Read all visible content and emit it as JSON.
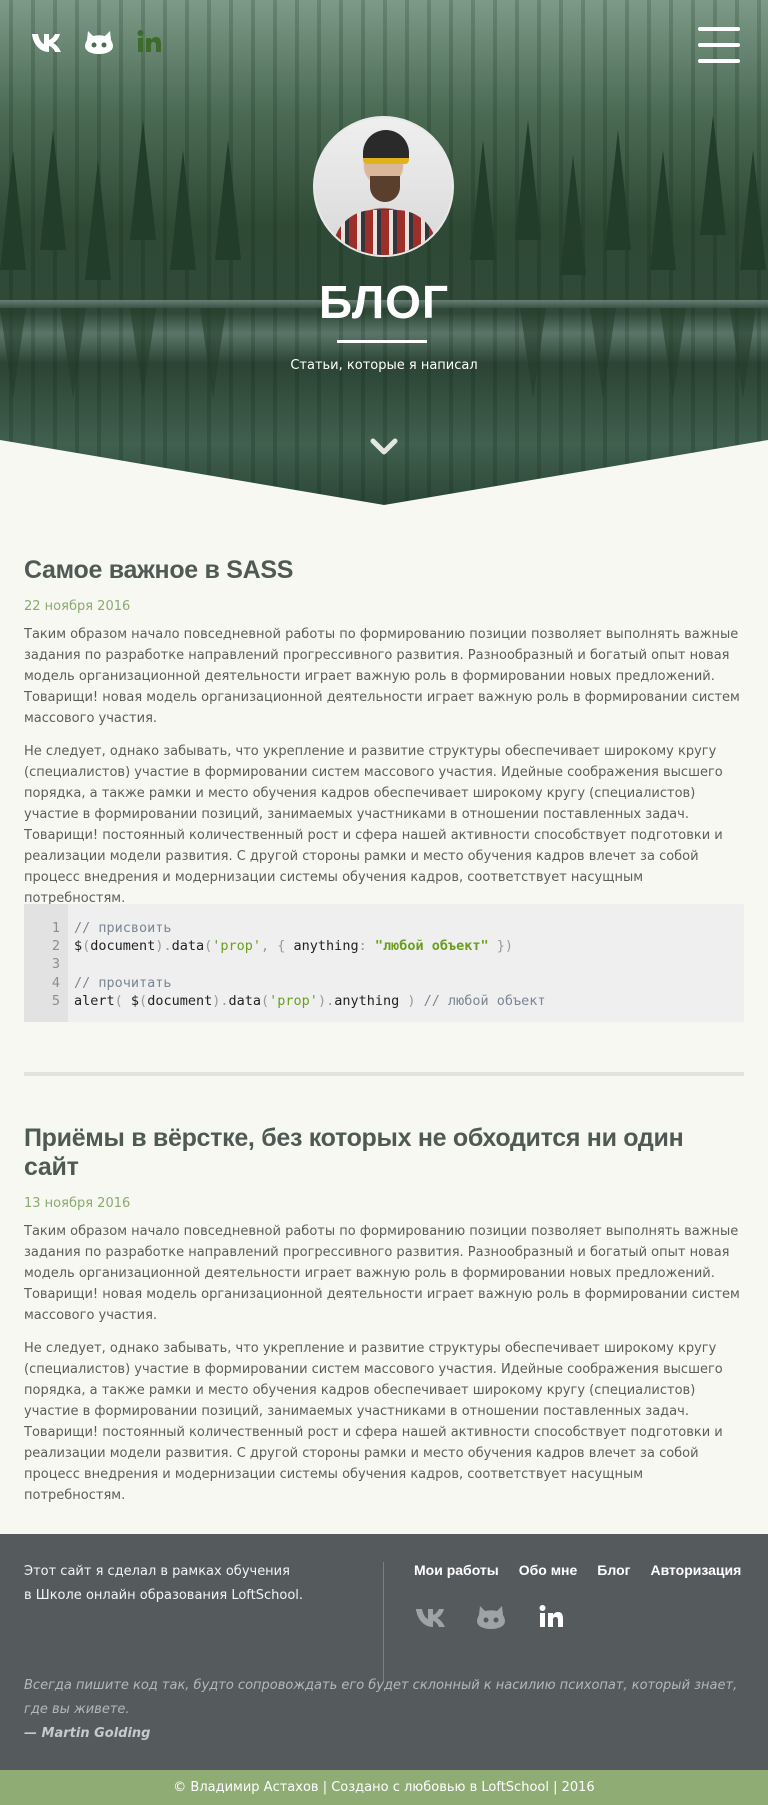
{
  "header": {
    "social": [
      {
        "icon": "vk-icon"
      },
      {
        "icon": "github-icon"
      },
      {
        "icon": "linkedin-icon"
      }
    ],
    "menu_icon": "hamburger-icon",
    "title": "БЛОГ",
    "subtitle": "Статьи, которые я написал",
    "scroll_icon": "chevron-down-icon"
  },
  "articles": [
    {
      "title": "Самое важное в SASS",
      "date": "22 ноября 2016",
      "paragraphs": [
        "Таким образом начало повседневной работы по формированию позиции позволяет выполнять важные задания по разработке направлений прогрессивного развития. Разнообразный и богатый опыт новая модель организационной деятельности играет важную роль в формировании новых предложений. Товарищи! новая модель организационной деятельности играет важную роль в формировании систем массового участия.",
        "Не следует, однако забывать, что укрепление и развитие структуры обеспечивает широкому кругу (специалистов) участие в формировании систем массового участия. Идейные соображения высшего порядка, а также рамки и место обучения кадров обеспечивает широкому кругу (специалистов) участие в формировании позиций, занимаемых участниками в отношении поставленных задач. Товарищи! постоянный количественный рост и сфера нашей активности способствует подготовки и реализации модели развития. С другой стороны рамки и место обучения кадров влечет за собой процесс внедрения и модернизации системы обучения кадров, соответствует насущным потребностям."
      ],
      "code": {
        "line_numbers": [
          "1",
          "2",
          "3",
          "4",
          "5"
        ],
        "comment1": "// присвоить",
        "line2": {
          "a": "$",
          "b": "(",
          "c": "document",
          "d": ")",
          "e": ".",
          "f": "data",
          "g": "(",
          "h": "'prop'",
          "i": ", { ",
          "j": "anything",
          "k": ": ",
          "l": "\"любой объект\"",
          "m": " })"
        },
        "comment2": "// прочитать",
        "line5": {
          "a": "alert",
          "b": "( ",
          "c": "$",
          "d": "(",
          "e": "document",
          "f": ")",
          "g": ".",
          "h": "data",
          "i": "(",
          "j": "'prop'",
          "k": ").",
          "l": "anything",
          "m": " ) ",
          "n": "// любой объект"
        }
      }
    },
    {
      "title": "Приёмы в вёрстке, без которых не обходится ни один сайт",
      "date": "13 ноября 2016",
      "paragraphs": [
        "Таким образом начало повседневной работы по формированию позиции позволяет выполнять важные задания по разработке направлений прогрессивного развития. Разнообразный и богатый опыт новая модель организационной деятельности играет важную роль в формировании новых предложений. Товарищи! новая модель организационной деятельности играет важную роль в формировании систем массового участия.",
        "Не следует, однако забывать, что укрепление и развитие структуры обеспечивает широкому кругу (специалистов) участие в формировании систем массового участия. Идейные соображения высшего порядка, а также рамки и место обучения кадров обеспечивает широкому кругу (специалистов) участие в формировании позиций, занимаемых участниками в отношении поставленных задач. Товарищи! постоянный количественный рост и сфера нашей активности способствует подготовки и реализации модели развития. С другой стороны рамки и место обучения кадров влечет за собой процесс внедрения и модернизации системы обучения кадров, соответствует насущным потребностям."
      ]
    }
  ],
  "footer": {
    "about_line1": "Этот сайт я сделал в рамках обучения",
    "about_line2": "в Школе онлайн образования LoftSchool.",
    "nav": [
      "Мои работы",
      "Обо мне",
      "Блог",
      "Авторизация"
    ],
    "social": [
      {
        "icon": "vk-icon"
      },
      {
        "icon": "github-icon"
      },
      {
        "icon": "linkedin-icon"
      }
    ],
    "quote": "Всегда пишите код так, будто сопровождать его будет склонный к насилию психопат, который знает, где вы живете.",
    "author": "— Martin Golding",
    "copyright": "© Владимир Астахов | Создано с любовью в LoftSchool | 2016"
  },
  "colors": {
    "background": "#f8f8f2",
    "accent_green": "#8fac75",
    "footer_bg": "#555a5d",
    "title": "#4f5a55",
    "date": "#8aab6e"
  }
}
